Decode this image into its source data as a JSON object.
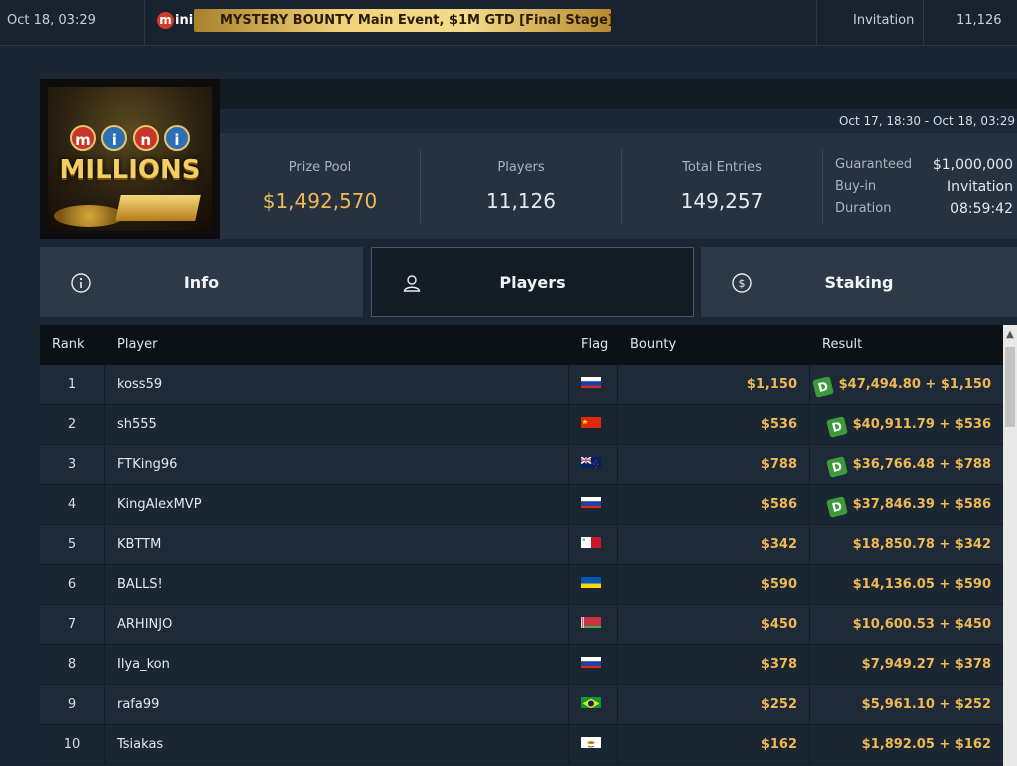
{
  "top_row": {
    "date": "Oct 18, 03:29",
    "banner_logo": "mini",
    "banner_title": "MYSTERY BOUNTY Main Event, $1M GTD [Final Stage]",
    "type": "Invitation",
    "count": "11,126"
  },
  "tournament": {
    "logo": {
      "top": "mini",
      "bottom": "MILLIONS"
    },
    "date_range": "Oct 17, 18:30 - Oct 18, 03:29",
    "stats": {
      "prize_pool_label": "Prize Pool",
      "prize_pool": "$1,492,570",
      "players_label": "Players",
      "players": "11,126",
      "entries_label": "Total Entries",
      "entries": "149,257"
    },
    "details": {
      "guaranteed_label": "Guaranteed",
      "guaranteed": "$1,000,000",
      "buyin_label": "Buy-in",
      "buyin": "Invitation",
      "duration_label": "Duration",
      "duration": "08:59:42"
    }
  },
  "tabs": [
    {
      "label": "Info",
      "icon": "info-icon"
    },
    {
      "label": "Players",
      "icon": "user-icon",
      "active": true
    },
    {
      "label": "Staking",
      "icon": "dollar-icon"
    }
  ],
  "table": {
    "columns": {
      "rank": "Rank",
      "player": "Player",
      "flag": "Flag",
      "bounty": "Bounty",
      "result": "Result"
    },
    "rows": [
      {
        "rank": "1",
        "player": "koss59",
        "flag": "russia",
        "bounty": "$1,150",
        "result": "$47,494.80 + $1,150",
        "badge": "D"
      },
      {
        "rank": "2",
        "player": "sh555",
        "flag": "china",
        "bounty": "$536",
        "result": "$40,911.79 + $536",
        "badge": "D"
      },
      {
        "rank": "3",
        "player": "FTKing96",
        "flag": "new-zealand",
        "bounty": "$788",
        "result": "$36,766.48 + $788",
        "badge": "D"
      },
      {
        "rank": "4",
        "player": "KingAlexMVP",
        "flag": "russia",
        "bounty": "$586",
        "result": "$37,846.39 + $586",
        "badge": "D"
      },
      {
        "rank": "5",
        "player": "KBTTM",
        "flag": "malta",
        "bounty": "$342",
        "result": "$18,850.78 + $342",
        "badge": ""
      },
      {
        "rank": "6",
        "player": "BALLS!",
        "flag": "ukraine",
        "bounty": "$590",
        "result": "$14,136.05 + $590",
        "badge": ""
      },
      {
        "rank": "7",
        "player": "ARHINJO",
        "flag": "belarus",
        "bounty": "$450",
        "result": "$10,600.53 + $450",
        "badge": ""
      },
      {
        "rank": "8",
        "player": "Ilya_kon",
        "flag": "russia",
        "bounty": "$378",
        "result": "$7,949.27 + $378",
        "badge": ""
      },
      {
        "rank": "9",
        "player": "rafa99",
        "flag": "brazil",
        "bounty": "$252",
        "result": "$5,961.10 + $252",
        "badge": ""
      },
      {
        "rank": "10",
        "player": "Tsiakas",
        "flag": "cyprus",
        "bounty": "$162",
        "result": "$1,892.05 + $162",
        "badge": ""
      }
    ]
  }
}
